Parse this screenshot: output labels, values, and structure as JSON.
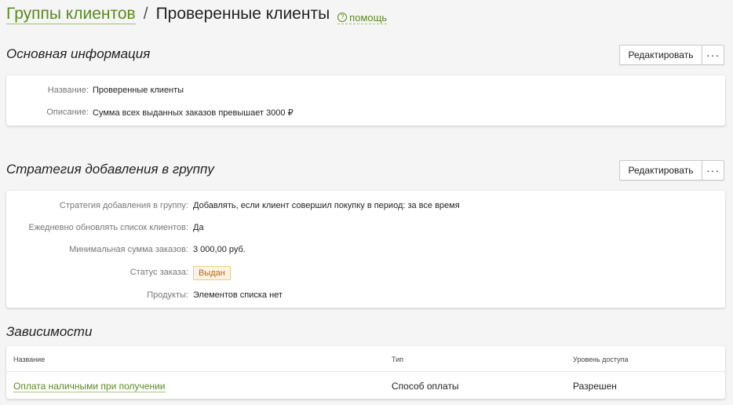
{
  "breadcrumb": {
    "parent": "Группы клиентов",
    "separator": "/",
    "current": "Проверенные клиенты",
    "help_icon": "?",
    "help_label": "помощь"
  },
  "basic_info": {
    "title": "Основная информация",
    "edit_label": "Редактировать",
    "more_label": "···",
    "fields": [
      {
        "label": "Название:",
        "value": "Проверенные клиенты"
      },
      {
        "label": "Описание:",
        "value": "Сумма всех выданных заказов превышает 3000 ₽"
      }
    ]
  },
  "strategy": {
    "title": "Стратегия добавления в группу",
    "edit_label": "Редактировать",
    "more_label": "···",
    "fields": [
      {
        "label": "Стратегия добавления в группу:",
        "value": "Добавлять, если клиент совершил покупку в период: за все время"
      },
      {
        "label": "Ежедневно обновлять список клиентов:",
        "value": "Да"
      },
      {
        "label": "Минимальная сумма заказов:",
        "value": "3 000,00 руб."
      },
      {
        "label": "Статус заказа:",
        "value": "Выдан"
      },
      {
        "label": "Продукты:",
        "value": "Элементов списка нет"
      }
    ]
  },
  "dependencies": {
    "title": "Зависимости",
    "columns": [
      "Название",
      "Тип",
      "Уровень доступа"
    ],
    "rows": [
      {
        "name": "Оплата наличными при получении",
        "type": "Способ оплаты",
        "access": "Разрешен"
      }
    ]
  },
  "colors": {
    "link": "#5b8a1e",
    "badge_bg": "#fdf3e2",
    "badge_text": "#b46a12"
  }
}
